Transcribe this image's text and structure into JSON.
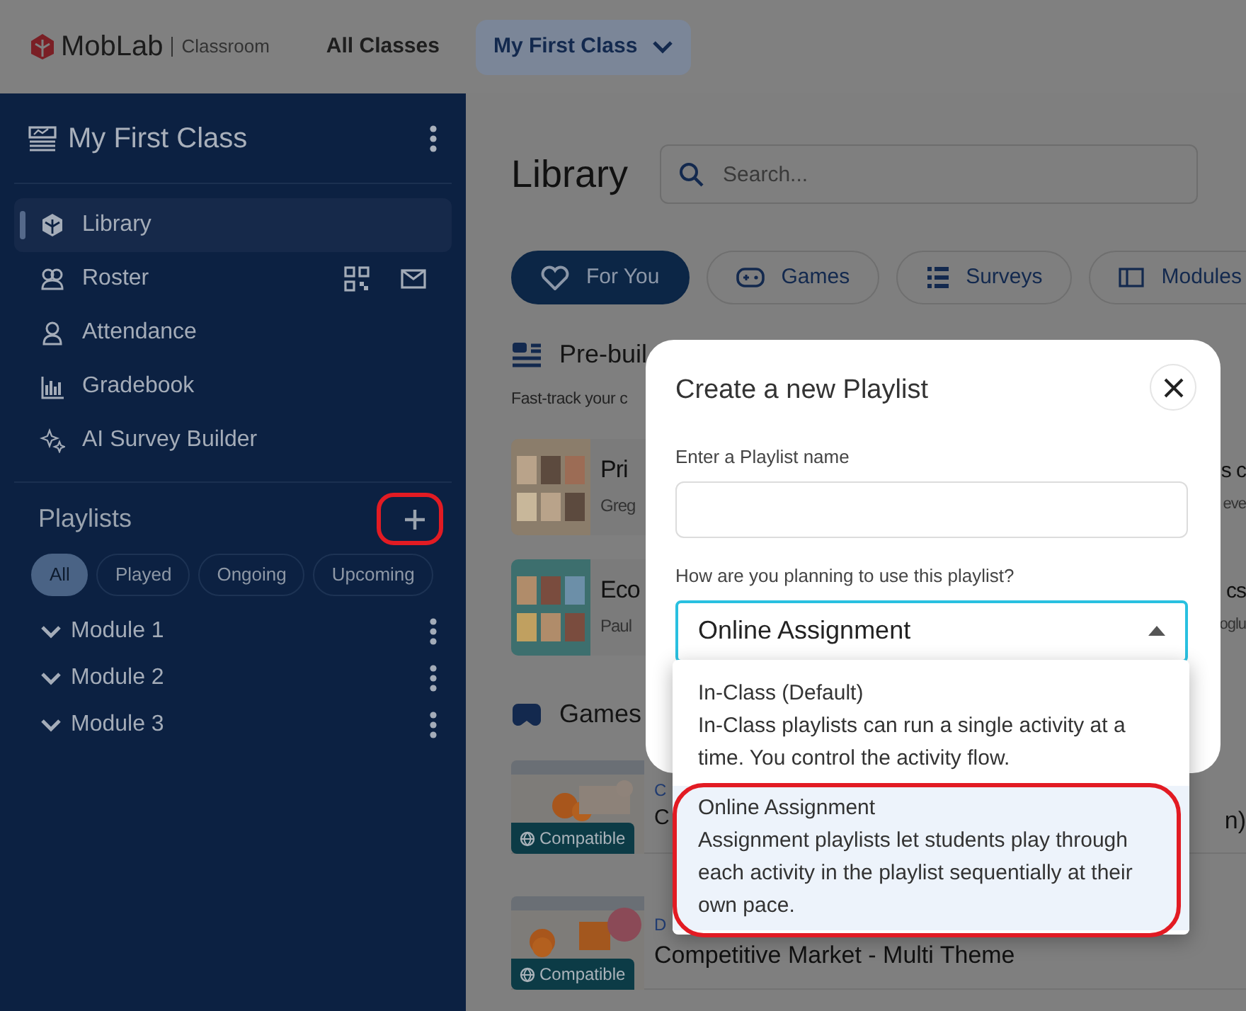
{
  "top_nav": {
    "logo": "MobLab",
    "product": "Classroom",
    "links": [
      {
        "label": "All Classes"
      }
    ],
    "class_switcher": "My First Class"
  },
  "sidebar": {
    "class_title": "My First Class",
    "nav": [
      {
        "label": "Library",
        "selected": true
      },
      {
        "label": "Roster",
        "selected": false
      },
      {
        "label": "Attendance",
        "selected": false
      },
      {
        "label": "Gradebook",
        "selected": false
      },
      {
        "label": "AI Survey Builder",
        "selected": false
      }
    ],
    "playlists": {
      "title": "Playlists",
      "add_highlighted": true,
      "filters": [
        {
          "label": "All",
          "selected": true
        },
        {
          "label": "Played",
          "selected": false
        },
        {
          "label": "Ongoing",
          "selected": false
        },
        {
          "label": "Upcoming",
          "selected": false
        }
      ],
      "items": [
        {
          "label": "Module 1"
        },
        {
          "label": "Module 2"
        },
        {
          "label": "Module 3"
        }
      ]
    }
  },
  "main": {
    "title": "Library",
    "search": {
      "placeholder": "Search..."
    },
    "tabs": [
      {
        "label": "For You",
        "selected": true
      },
      {
        "label": "Games",
        "selected": false
      },
      {
        "label": "Surveys",
        "selected": false
      },
      {
        "label": "Modules",
        "selected": false
      }
    ],
    "prebuilt": {
      "title": "Pre-buil",
      "subtitle": "Fast-track your c",
      "rows": [
        {
          "left": {
            "title": "Pri",
            "author": "Greg"
          },
          "right": {
            "title": "s c",
            "author": "eve"
          }
        },
        {
          "left": {
            "title": "Eco",
            "author": "Paul"
          },
          "right": {
            "title": "cs",
            "author": "oglu"
          }
        }
      ]
    },
    "games": {
      "title": "Games",
      "cards": [
        {
          "category": "C",
          "title": "C",
          "title_end": "n)",
          "badge": "Compatible"
        },
        {
          "category": "D",
          "title": "Competitive Market - Multi Theme",
          "badge": "Compatible"
        }
      ]
    }
  },
  "modal": {
    "title": "Create a new Playlist",
    "name_label": "Enter a Playlist name",
    "use_label": "How are you planning to use this playlist?",
    "use_value": "Online Assignment",
    "options": [
      {
        "title": "In-Class (Default)",
        "description": "In-Class playlists can run a single activity at a time. You control the activity flow.",
        "selected": false,
        "highlighted": false
      },
      {
        "title": "Online Assignment",
        "description": "Assignment playlists let students play through each activity in the playlist sequentially at their own pace.",
        "selected": true,
        "highlighted": true
      }
    ]
  }
}
